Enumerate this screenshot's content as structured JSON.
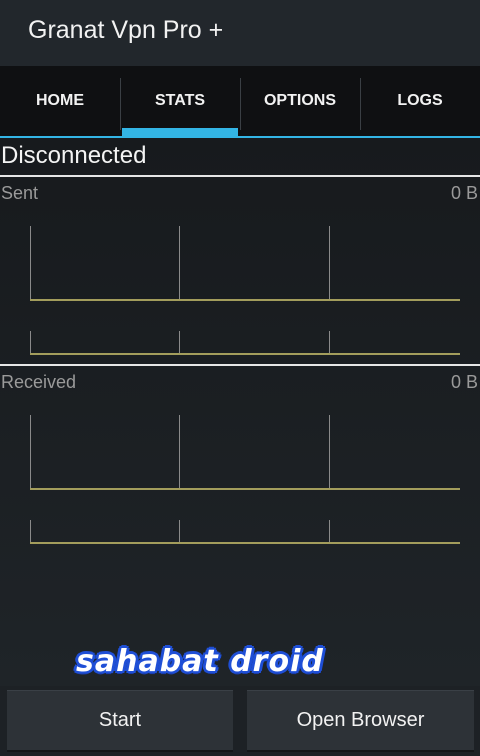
{
  "app": {
    "title": "Granat Vpn Pro +"
  },
  "tabs": [
    {
      "label": "HOME"
    },
    {
      "label": "STATS"
    },
    {
      "label": "OPTIONS"
    },
    {
      "label": "LOGS"
    }
  ],
  "active_tab": "STATS",
  "stats": {
    "status": "Disconnected",
    "sent": {
      "label": "Sent",
      "value": "0 B"
    },
    "received": {
      "label": "Received",
      "value": "0 B"
    }
  },
  "watermark": "sahabat droid",
  "buttons": {
    "start_label": "Start",
    "open_browser_label": "Open Browser"
  },
  "colors": {
    "accent": "#33b5e5",
    "graph_line": "#a39d5c",
    "grid_line": "#8a8a8a"
  }
}
